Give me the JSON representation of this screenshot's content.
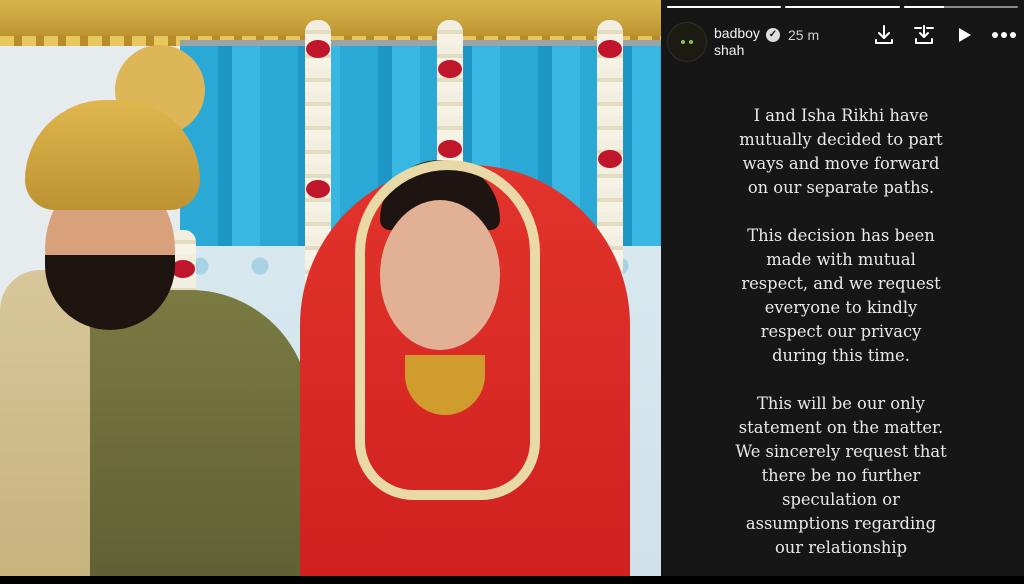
{
  "photo": {
    "alt_subject": "wedding-couple-photo"
  },
  "story": {
    "progress_segments": [
      1,
      1,
      0.35
    ],
    "username": "badboyshah",
    "verified": true,
    "timestamp": "25 m",
    "actions": [
      {
        "name": "download-icon"
      },
      {
        "name": "download-stack-icon"
      },
      {
        "name": "play-icon"
      },
      {
        "name": "more-icon"
      }
    ],
    "paragraphs": [
      "I and Isha Rikhi have\nmutually decided to part\nways and move forward\non our separate paths.",
      "This decision has been\nmade with mutual\nrespect, and we request\neveryone to kindly\nrespect our privacy\nduring this time.",
      "This will be our only\nstatement on the matter.\nWe sincerely request that\nthere be no further\nspeculation or\nassumptions regarding\nour relationship"
    ]
  }
}
